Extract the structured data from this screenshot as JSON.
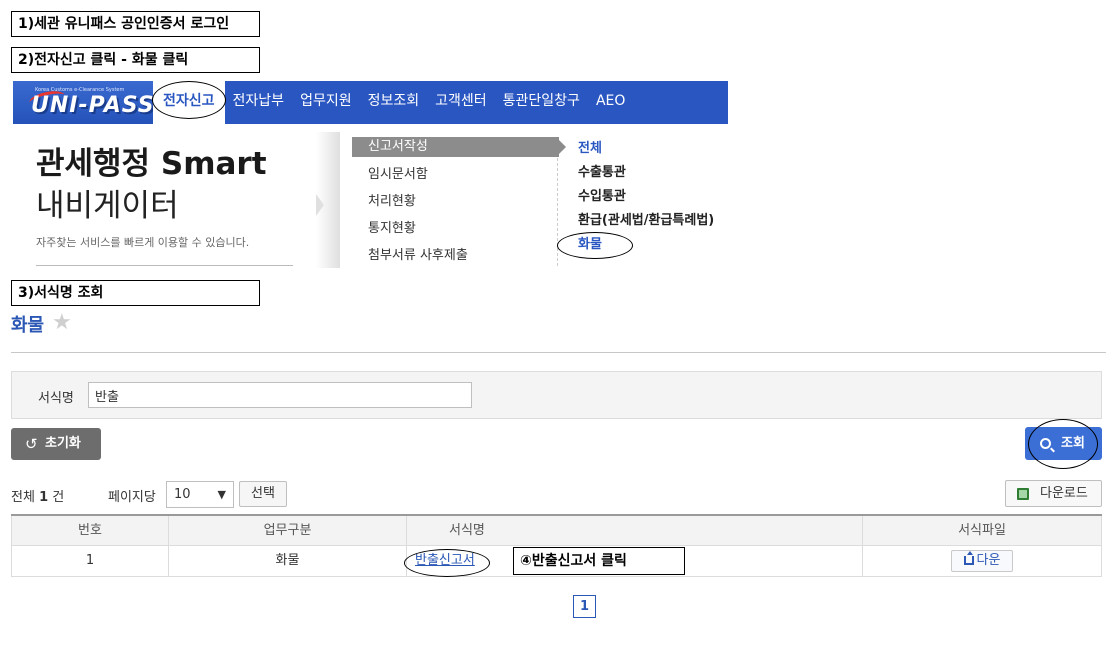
{
  "steps": {
    "step1": "1)세관 유니패스 공인인증서 로그인",
    "step2": "2)전자신고 클릭 - 화물 클릭",
    "step3": "3)서식명 조회",
    "step4": "④반출신고서 클릭"
  },
  "topnav": {
    "logo_text": "UNI-PASS",
    "logo_subtitle": "Korea Customs e-Clearance System",
    "items": [
      "전자신고",
      "전자납부",
      "업무지원",
      "정보조회",
      "고객센터",
      "통관단일창구",
      "AEO"
    ]
  },
  "promo": {
    "title_line1": "관세행정 Smart",
    "title_line2": "내비게이터",
    "desc": "자주찾는 서비스를 빠르게 이용할 수 있습니다."
  },
  "submenu": {
    "items": [
      "신고서작성",
      "임시문서함",
      "처리현황",
      "통지현황",
      "첨부서류 사후제출"
    ]
  },
  "categories": {
    "items": [
      "전체",
      "수출통관",
      "수입통관",
      "환급(관세법/환급특례법)",
      "화물"
    ]
  },
  "page": {
    "title": "화물"
  },
  "search": {
    "label": "서식명",
    "value": "반출"
  },
  "buttons": {
    "reset": "초기화",
    "search": "조회",
    "select": "선택",
    "download": "다운로드"
  },
  "list": {
    "total_prefix": "전체",
    "total_count": "1",
    "total_suffix": "건",
    "per_page_label": "페이지당",
    "per_page_value": "10"
  },
  "table": {
    "headers": [
      "번호",
      "업무구분",
      "서식명",
      "서식파일"
    ],
    "rows": [
      {
        "no": "1",
        "category": "화물",
        "form_name": "반출신고서",
        "file_button": "다운"
      }
    ]
  },
  "pagination": {
    "current": "1"
  },
  "colors": {
    "nav_blue": "#2956c1",
    "title_blue": "#2b57b5",
    "search_button": "#3b6fd6",
    "reset_button": "#6d6d6d"
  }
}
